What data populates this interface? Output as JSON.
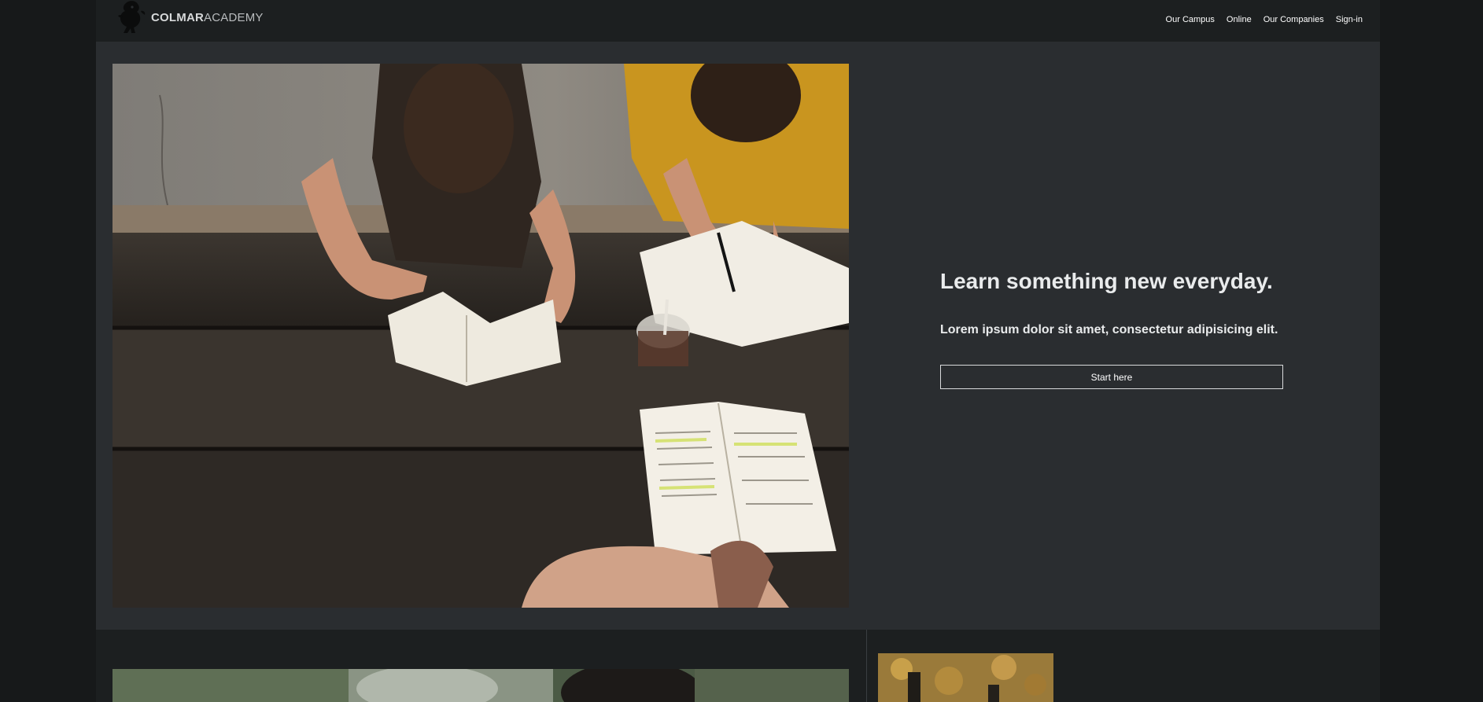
{
  "header": {
    "logo_bold": "COLMAR",
    "logo_light": "ACADEMY",
    "nav": [
      {
        "label": "Our Campus"
      },
      {
        "label": "Online"
      },
      {
        "label": "Our Companies"
      },
      {
        "label": "Sign-in"
      }
    ]
  },
  "hero": {
    "title": "Learn something new everyday.",
    "subtitle": "Lorem ipsum dolor sit amet, consectetur adipisicing elit.",
    "button_label": "Start here"
  },
  "colors": {
    "page_background": "#2a2d30",
    "outer_background": "#17191a",
    "header_background": "#1c1f20",
    "text": "#e9ebec"
  }
}
